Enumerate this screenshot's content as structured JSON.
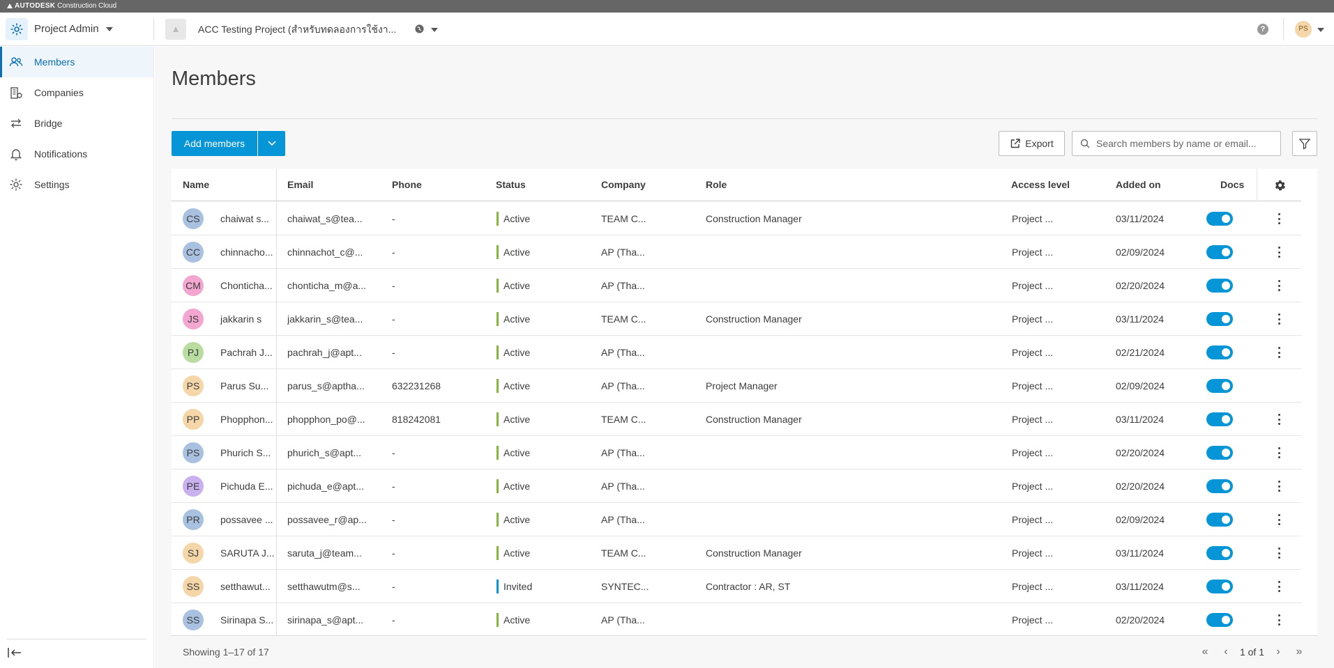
{
  "brand": {
    "name": "AUTODESK",
    "product": "Construction Cloud"
  },
  "topbar": {
    "app_title": "Project Admin",
    "project_name": "ACC Testing Project (สำหรับทดลองการใช้งา...",
    "user_initials": "PS",
    "help_label": "?"
  },
  "sidebar": {
    "items": [
      {
        "label": "Members",
        "icon": "people-icon",
        "active": true
      },
      {
        "label": "Companies",
        "icon": "companies-icon",
        "active": false
      },
      {
        "label": "Bridge",
        "icon": "bridge-icon",
        "active": false
      },
      {
        "label": "Notifications",
        "icon": "bell-icon",
        "active": false
      },
      {
        "label": "Settings",
        "icon": "gear-icon",
        "active": false
      }
    ]
  },
  "main": {
    "title": "Members",
    "add_members_label": "Add members",
    "export_label": "Export",
    "search_placeholder": "Search members by name or email..."
  },
  "table": {
    "headers": {
      "name": "Name",
      "email": "Email",
      "phone": "Phone",
      "status": "Status",
      "company": "Company",
      "role": "Role",
      "access": "Access level",
      "added": "Added on",
      "docs": "Docs"
    },
    "rows": [
      {
        "initials": "CS",
        "avatar_color": "#a9c1e0",
        "name": "chaiwat s...",
        "email": "chaiwat_s@tea...",
        "phone": "-",
        "status": "Active",
        "status_color": "#87b340",
        "company": "TEAM C...",
        "role": "Construction Manager",
        "access": "Project ...",
        "added": "03/11/2024",
        "docs": true,
        "menu": true
      },
      {
        "initials": "CC",
        "avatar_color": "#a9c1e0",
        "name": "chinnacho...",
        "email": "chinnachot_c@...",
        "phone": "-",
        "status": "Active",
        "status_color": "#87b340",
        "company": "AP (Tha...",
        "role": "",
        "access": "Project ...",
        "added": "02/09/2024",
        "docs": true,
        "menu": true
      },
      {
        "initials": "CM",
        "avatar_color": "#f3a6cf",
        "name": "Chonticha...",
        "email": "chonticha_m@a...",
        "phone": "-",
        "status": "Active",
        "status_color": "#87b340",
        "company": "AP (Tha...",
        "role": "",
        "access": "Project ...",
        "added": "02/20/2024",
        "docs": true,
        "menu": true
      },
      {
        "initials": "JS",
        "avatar_color": "#f3a6cf",
        "name": "jakkarin s",
        "email": "jakkarin_s@tea...",
        "phone": "-",
        "status": "Active",
        "status_color": "#87b340",
        "company": "TEAM C...",
        "role": "Construction Manager",
        "access": "Project ...",
        "added": "03/11/2024",
        "docs": true,
        "menu": true
      },
      {
        "initials": "PJ",
        "avatar_color": "#b9dca0",
        "name": "Pachrah J...",
        "email": "pachrah_j@apt...",
        "phone": "-",
        "status": "Active",
        "status_color": "#87b340",
        "company": "AP (Tha...",
        "role": "",
        "access": "Project ...",
        "added": "02/21/2024",
        "docs": true,
        "menu": true
      },
      {
        "initials": "PS",
        "avatar_color": "#f5d6a8",
        "name": "Parus Su...",
        "email": "parus_s@aptha...",
        "phone": "632231268",
        "status": "Active",
        "status_color": "#87b340",
        "company": "AP (Tha...",
        "role": "Project Manager",
        "access": "Project ...",
        "added": "02/09/2024",
        "docs": true,
        "menu": false
      },
      {
        "initials": "PP",
        "avatar_color": "#f5d6a8",
        "name": "Phopphon...",
        "email": "phopphon_po@...",
        "phone": "818242081",
        "status": "Active",
        "status_color": "#87b340",
        "company": "TEAM C...",
        "role": "Construction Manager",
        "access": "Project ...",
        "added": "03/11/2024",
        "docs": true,
        "menu": true
      },
      {
        "initials": "PS",
        "avatar_color": "#a9c1e0",
        "name": "Phurich S...",
        "email": "phurich_s@apt...",
        "phone": "-",
        "status": "Active",
        "status_color": "#87b340",
        "company": "AP (Tha...",
        "role": "",
        "access": "Project ...",
        "added": "02/20/2024",
        "docs": true,
        "menu": true
      },
      {
        "initials": "PE",
        "avatar_color": "#c9b0ef",
        "name": "Pichuda E...",
        "email": "pichuda_e@apt...",
        "phone": "-",
        "status": "Active",
        "status_color": "#87b340",
        "company": "AP (Tha...",
        "role": "",
        "access": "Project ...",
        "added": "02/20/2024",
        "docs": true,
        "menu": true
      },
      {
        "initials": "PR",
        "avatar_color": "#a9c1e0",
        "name": "possavee ...",
        "email": "possavee_r@ap...",
        "phone": "-",
        "status": "Active",
        "status_color": "#87b340",
        "company": "AP (Tha...",
        "role": "",
        "access": "Project ...",
        "added": "02/09/2024",
        "docs": true,
        "menu": true
      },
      {
        "initials": "SJ",
        "avatar_color": "#f5d6a8",
        "name": "SARUTA J...",
        "email": "saruta_j@team...",
        "phone": "-",
        "status": "Active",
        "status_color": "#87b340",
        "company": "TEAM C...",
        "role": "Construction Manager",
        "access": "Project ...",
        "added": "03/11/2024",
        "docs": true,
        "menu": true
      },
      {
        "initials": "SS",
        "avatar_color": "#f5d6a8",
        "name": "setthawut...",
        "email": "setthawutm@s...",
        "phone": "-",
        "status": "Invited",
        "status_color": "#0696d7",
        "company": "SYNTEC...",
        "role": "Contractor : AR, ST",
        "access": "Project ...",
        "added": "03/11/2024",
        "docs": true,
        "menu": true
      },
      {
        "initials": "SS",
        "avatar_color": "#a9c1e0",
        "name": "Sirinapa S...",
        "email": "sirinapa_s@apt...",
        "phone": "-",
        "status": "Active",
        "status_color": "#87b340",
        "company": "AP (Tha...",
        "role": "",
        "access": "Project ...",
        "added": "02/20/2024",
        "docs": true,
        "menu": true
      }
    ]
  },
  "footer": {
    "showing": "Showing 1–17 of 17",
    "page_info": "1 of 1"
  }
}
